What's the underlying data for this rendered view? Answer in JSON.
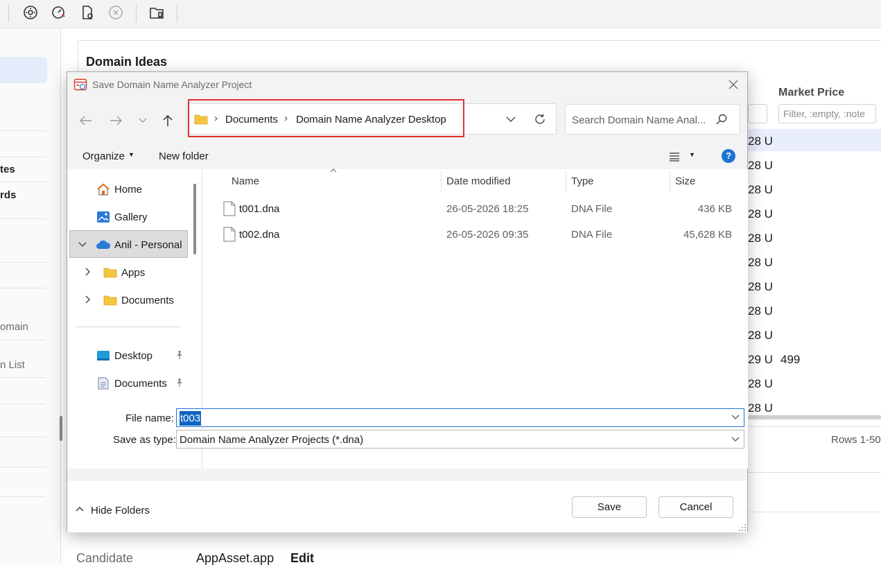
{
  "app": {
    "toolbar": {
      "icons": [
        "settings-gear-icon",
        "speedometer-icon",
        "document-settings-icon",
        "close-circle-icon",
        "folder-bookmark-icon"
      ]
    },
    "sidebar": {
      "labels": [
        {
          "text": "tes",
          "style": "bold"
        },
        {
          "text": "rds",
          "style": "bold"
        },
        {
          "text": "omain",
          "style": "muted"
        },
        {
          "text": "n List",
          "style": "muted"
        }
      ]
    },
    "panel": {
      "title": "Domain Ideas",
      "column_header": "Market Price",
      "filter_placeholder": "Filter, :empty, :note",
      "partial_cells": [
        "28 U",
        "28 U",
        "28 U",
        "28 U",
        "28 U",
        "28 U",
        "28 U",
        "28 U",
        "28 U",
        "29 U",
        "28 U",
        "28 U"
      ],
      "price_value": "499",
      "rows_count": "Rows 1-50"
    },
    "bottom": {
      "label": "Candidate",
      "value": "AppAsset.app",
      "action": "Edit"
    }
  },
  "dialog": {
    "title": "Save Domain Name Analyzer Project",
    "address": {
      "breadcrumbs": [
        "Documents",
        "Domain Name Analyzer Desktop"
      ]
    },
    "search": {
      "placeholder": "Search Domain Name Anal..."
    },
    "commands": {
      "organize": "Organize",
      "new_folder": "New folder"
    },
    "tree": {
      "items": [
        {
          "label": "Home",
          "icon": "home-icon"
        },
        {
          "label": "Gallery",
          "icon": "gallery-icon"
        },
        {
          "label": "Anil - Personal",
          "icon": "cloud-icon",
          "selected": true
        },
        {
          "label": "Apps",
          "icon": "folder-icon"
        },
        {
          "label": "Documents",
          "icon": "folder-icon"
        },
        {
          "label": "Desktop",
          "icon": "desktop-icon",
          "pinned": true
        },
        {
          "label": "Documents",
          "icon": "documents-icon",
          "pinned": true
        }
      ]
    },
    "list": {
      "columns": [
        "Name",
        "Date modified",
        "Type",
        "Size"
      ],
      "rows": [
        {
          "name": "t001.dna",
          "date": "26-05-2026 18:25",
          "type": "DNA File",
          "size": "436 KB"
        },
        {
          "name": "t002.dna",
          "date": "26-05-2026 09:35",
          "type": "DNA File",
          "size": "45,628 KB"
        }
      ]
    },
    "file_name": {
      "label": "File name:",
      "value": "t003"
    },
    "save_type": {
      "label": "Save as type:",
      "value": "Domain Name Analyzer Projects (*.dna)"
    },
    "hide_folders": "Hide Folders",
    "buttons": {
      "save": "Save",
      "cancel": "Cancel"
    }
  }
}
